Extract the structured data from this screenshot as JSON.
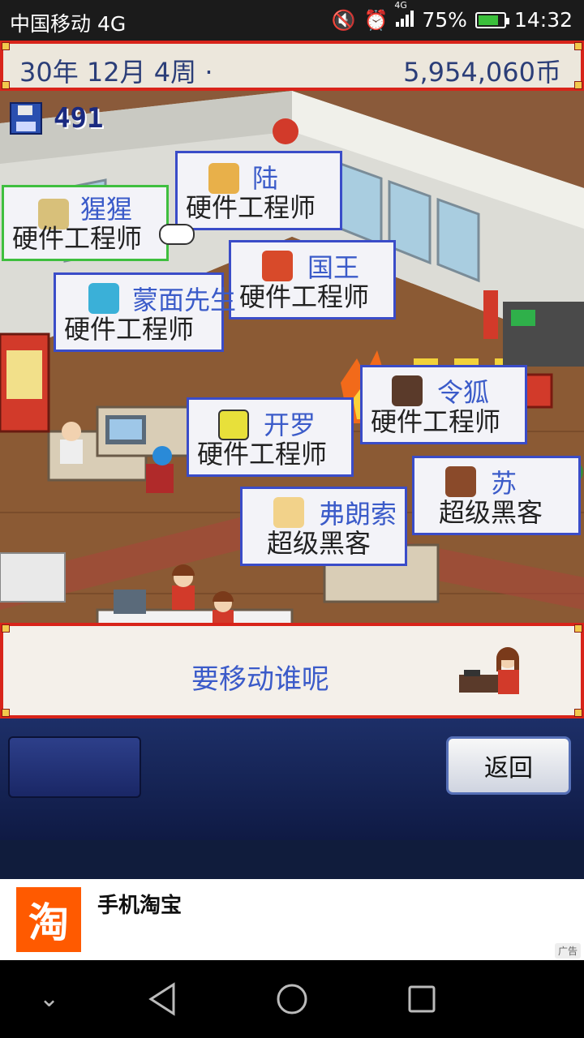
{
  "status_bar": {
    "carrier": "中国移动 4G",
    "network_badge": "4G",
    "battery": "75%",
    "time": "14:32"
  },
  "header": {
    "date": "30年 12月 4周 ·",
    "money": "5,954,060币"
  },
  "saves": {
    "count": "491"
  },
  "staff": [
    {
      "name": "猩猩",
      "role": "硬件工程师",
      "selected": true
    },
    {
      "name": "陆",
      "role": "硬件工程师"
    },
    {
      "name": "国王",
      "role": "硬件工程师"
    },
    {
      "name": "蒙面先生",
      "role": "硬件工程师"
    },
    {
      "name": "开罗",
      "role": "硬件工程师"
    },
    {
      "name": "令狐",
      "role": "硬件工程师"
    },
    {
      "name": "苏",
      "role": "超级黑客"
    },
    {
      "name": "弗朗索",
      "role": "超级黑客"
    }
  ],
  "prompt": {
    "text": "要移动谁呢"
  },
  "buttons": {
    "back": "返回"
  },
  "ad": {
    "app_name": "手机淘宝",
    "logo_char": "淘",
    "tag": "广告"
  },
  "colors": {
    "frame_red": "#d8241a",
    "name_blue": "#3b5bc9",
    "card_border": "#3a4cc8",
    "selected_border": "#3fbf3f"
  }
}
